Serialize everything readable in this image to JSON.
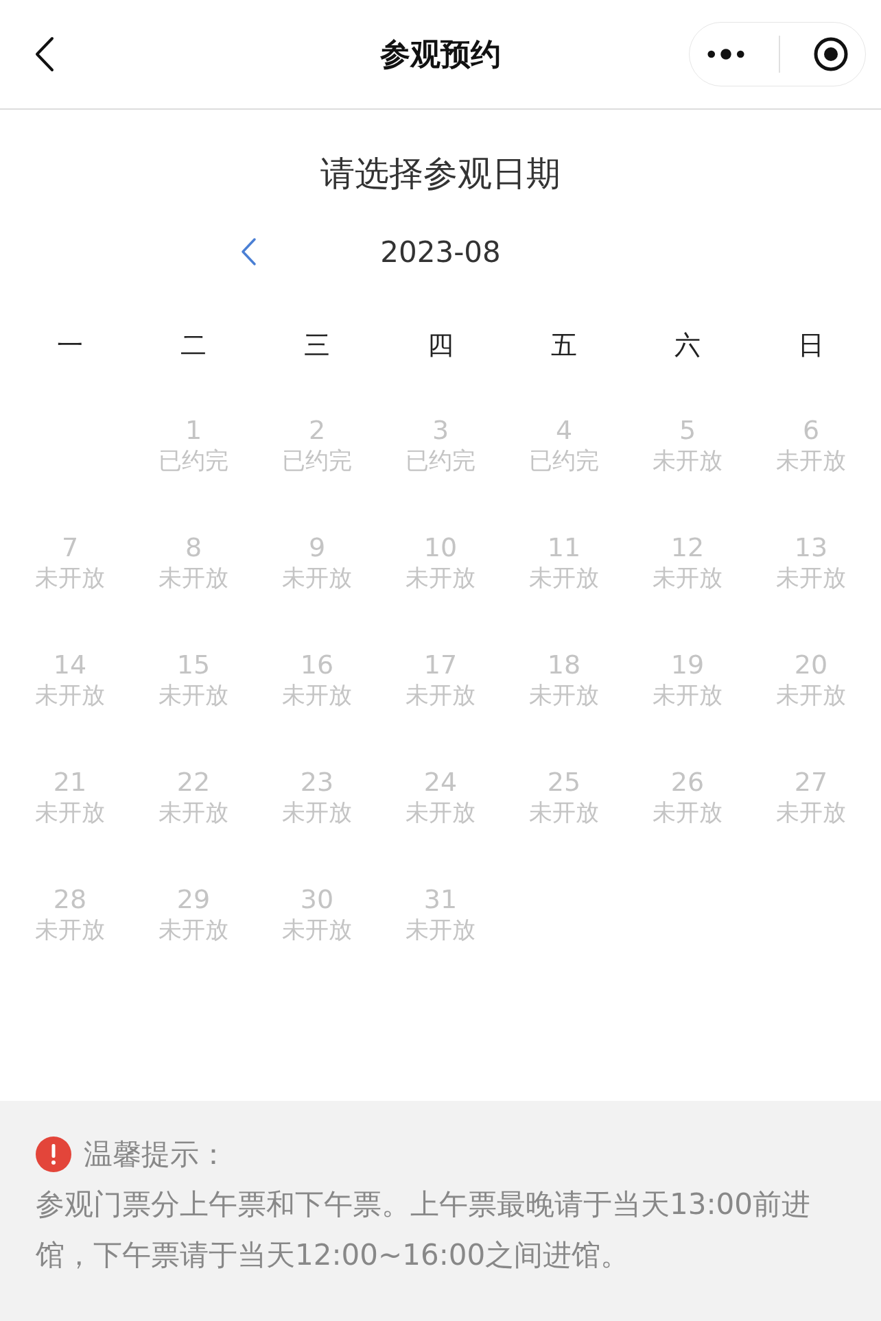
{
  "nav": {
    "title": "参观预约"
  },
  "calendar": {
    "heading": "请选择参观日期",
    "month": "2023-08",
    "weekdays": [
      "一",
      "二",
      "三",
      "四",
      "五",
      "六",
      "日"
    ],
    "days": [
      {
        "kind": "empty"
      },
      {
        "kind": "day",
        "date": "1",
        "status": "已约完"
      },
      {
        "kind": "day",
        "date": "2",
        "status": "已约完"
      },
      {
        "kind": "day",
        "date": "3",
        "status": "已约完"
      },
      {
        "kind": "day",
        "date": "4",
        "status": "已约完"
      },
      {
        "kind": "day",
        "date": "5",
        "status": "未开放"
      },
      {
        "kind": "day",
        "date": "6",
        "status": "未开放"
      },
      {
        "kind": "day",
        "date": "7",
        "status": "未开放"
      },
      {
        "kind": "day",
        "date": "8",
        "status": "未开放"
      },
      {
        "kind": "day",
        "date": "9",
        "status": "未开放"
      },
      {
        "kind": "day",
        "date": "10",
        "status": "未开放"
      },
      {
        "kind": "day",
        "date": "11",
        "status": "未开放"
      },
      {
        "kind": "day",
        "date": "12",
        "status": "未开放"
      },
      {
        "kind": "day",
        "date": "13",
        "status": "未开放"
      },
      {
        "kind": "day",
        "date": "14",
        "status": "未开放"
      },
      {
        "kind": "day",
        "date": "15",
        "status": "未开放"
      },
      {
        "kind": "day",
        "date": "16",
        "status": "未开放"
      },
      {
        "kind": "day",
        "date": "17",
        "status": "未开放"
      },
      {
        "kind": "day",
        "date": "18",
        "status": "未开放"
      },
      {
        "kind": "day",
        "date": "19",
        "status": "未开放"
      },
      {
        "kind": "day",
        "date": "20",
        "status": "未开放"
      },
      {
        "kind": "day",
        "date": "21",
        "status": "未开放"
      },
      {
        "kind": "day",
        "date": "22",
        "status": "未开放"
      },
      {
        "kind": "day",
        "date": "23",
        "status": "未开放"
      },
      {
        "kind": "day",
        "date": "24",
        "status": "未开放"
      },
      {
        "kind": "day",
        "date": "25",
        "status": "未开放"
      },
      {
        "kind": "day",
        "date": "26",
        "status": "未开放"
      },
      {
        "kind": "day",
        "date": "27",
        "status": "未开放"
      },
      {
        "kind": "day",
        "date": "28",
        "status": "未开放"
      },
      {
        "kind": "day",
        "date": "29",
        "status": "未开放"
      },
      {
        "kind": "day",
        "date": "30",
        "status": "未开放"
      },
      {
        "kind": "day",
        "date": "31",
        "status": "未开放"
      }
    ]
  },
  "notice": {
    "title": "温馨提示：",
    "text": "参观门票分上午票和下午票。上午票最晚请于当天13:00前进馆，下午票请于当天12:00~16:00之间进馆。"
  }
}
